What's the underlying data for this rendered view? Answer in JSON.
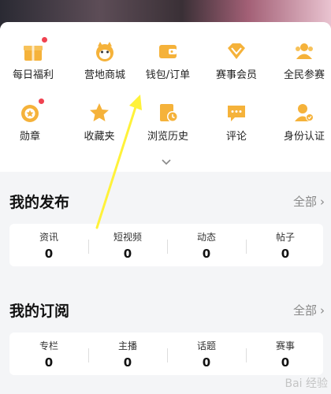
{
  "grid": [
    {
      "label": "每日福利",
      "icon": "gift-icon",
      "badge": true
    },
    {
      "label": "营地商城",
      "icon": "mascot-icon",
      "badge": false
    },
    {
      "label": "钱包/订单",
      "icon": "wallet-icon",
      "badge": false
    },
    {
      "label": "赛事会员",
      "icon": "diamond-icon",
      "badge": false
    },
    {
      "label": "全民参赛",
      "icon": "users-icon",
      "badge": false
    },
    {
      "label": "勋章",
      "icon": "medal-icon",
      "badge": true
    },
    {
      "label": "收藏夹",
      "icon": "star-icon",
      "badge": false
    },
    {
      "label": "浏览历史",
      "icon": "history-icon",
      "badge": false
    },
    {
      "label": "评论",
      "icon": "comment-icon",
      "badge": false
    },
    {
      "label": "身份认证",
      "icon": "id-verify-icon",
      "badge": false
    }
  ],
  "colors": {
    "accent": "#f5b23a",
    "badge": "#f04250",
    "arrow": "#fff23a"
  },
  "publish": {
    "title": "我的发布",
    "all": "全部",
    "items": [
      {
        "label": "资讯",
        "value": "0"
      },
      {
        "label": "短视频",
        "value": "0"
      },
      {
        "label": "动态",
        "value": "0"
      },
      {
        "label": "帖子",
        "value": "0"
      }
    ]
  },
  "subscribe": {
    "title": "我的订阅",
    "all": "全部",
    "items": [
      {
        "label": "专栏",
        "value": "0"
      },
      {
        "label": "主播",
        "value": "0"
      },
      {
        "label": "话题",
        "value": "0"
      },
      {
        "label": "赛事",
        "value": "0"
      }
    ]
  }
}
